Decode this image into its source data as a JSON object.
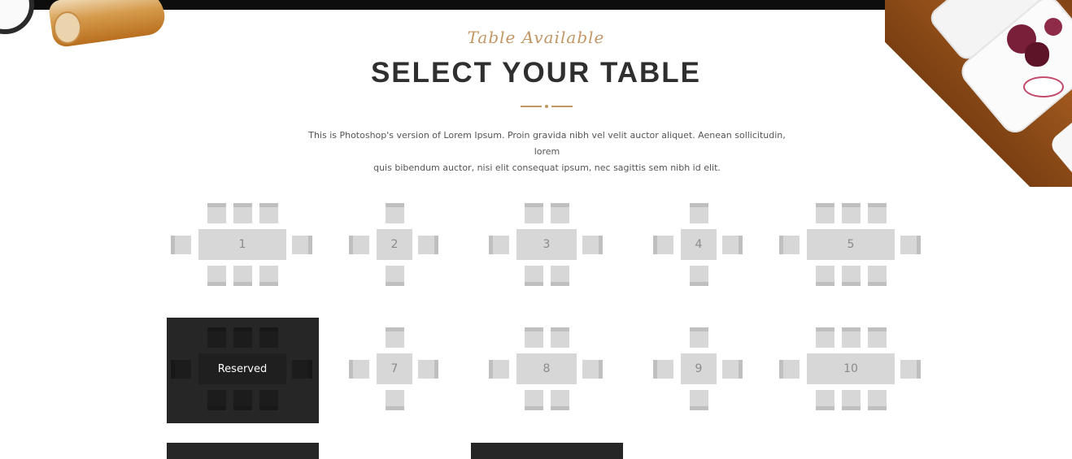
{
  "header": {
    "subtitle": "Table Available",
    "title": "SELECT YOUR TABLE",
    "description_line1": "This is Photoshop's version of Lorem Ipsum. Proin gravida nibh vel velit auctor aliquet. Aenean sollicitudin, lorem",
    "description_line2": "quis bibendum auctor, nisi elit consequat ipsum, nec sagittis sem nibh id elit."
  },
  "tables": [
    {
      "label": "1",
      "seats": 8,
      "status": "available"
    },
    {
      "label": "2",
      "seats": 4,
      "status": "available"
    },
    {
      "label": "3",
      "seats": 6,
      "status": "available"
    },
    {
      "label": "4",
      "seats": 4,
      "status": "available"
    },
    {
      "label": "5",
      "seats": 8,
      "status": "available"
    },
    {
      "label": "Reserved",
      "seats": 8,
      "status": "reserved"
    },
    {
      "label": "7",
      "seats": 4,
      "status": "available"
    },
    {
      "label": "8",
      "seats": 6,
      "status": "available"
    },
    {
      "label": "9",
      "seats": 4,
      "status": "available"
    },
    {
      "label": "10",
      "seats": 8,
      "status": "available"
    }
  ],
  "colors": {
    "accent": "#c29664",
    "reserved_bg": "#262626",
    "table_fill": "#d7d7d7"
  }
}
